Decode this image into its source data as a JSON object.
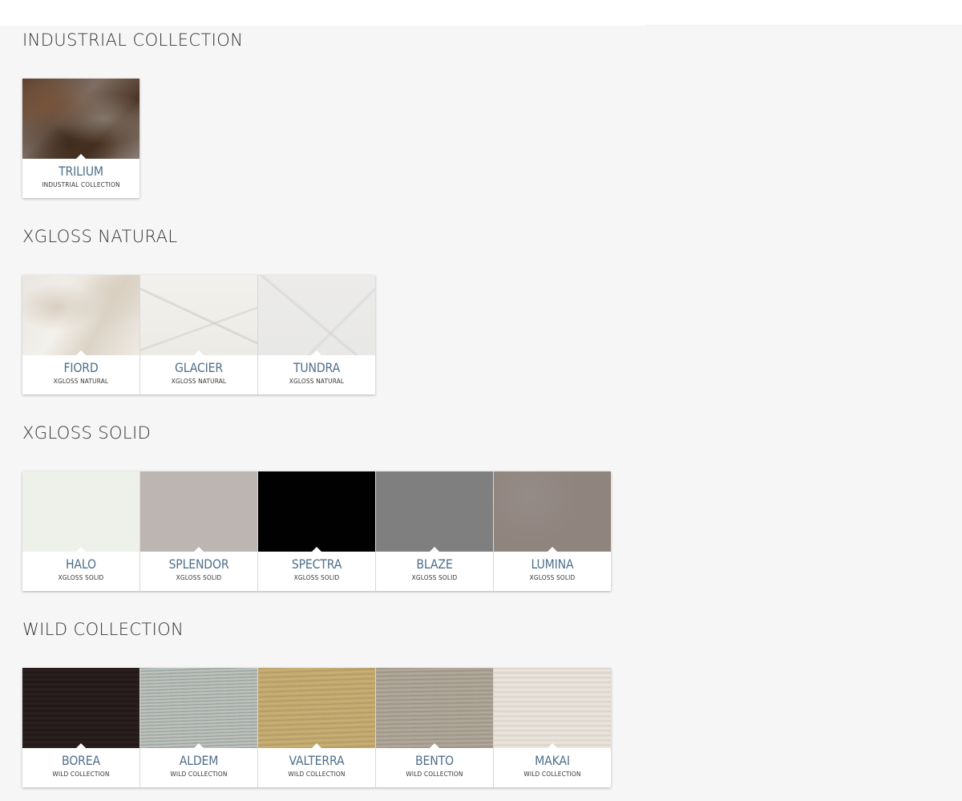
{
  "sections": [
    {
      "title": "INDUSTRIAL COLLECTION",
      "items": [
        {
          "name": "TRILIUM",
          "collection": "INDUSTRIAL COLLECTION"
        }
      ]
    },
    {
      "title": "XGLOSS NATURAL",
      "items": [
        {
          "name": "FIORD",
          "collection": "XGLOSS NATURAL"
        },
        {
          "name": "GLACIER",
          "collection": "XGLOSS NATURAL"
        },
        {
          "name": "TUNDRA",
          "collection": "XGLOSS NATURAL"
        }
      ]
    },
    {
      "title": "XGLOSS SOLID",
      "items": [
        {
          "name": "HALO",
          "collection": "XGLOSS SOLID"
        },
        {
          "name": "SPLENDOR",
          "collection": "XGLOSS SOLID"
        },
        {
          "name": "SPECTRA",
          "collection": "XGLOSS SOLID"
        },
        {
          "name": "BLAZE",
          "collection": "XGLOSS SOLID"
        },
        {
          "name": "LUMINA",
          "collection": "XGLOSS SOLID"
        }
      ]
    },
    {
      "title": "WILD COLLECTION",
      "items": [
        {
          "name": "BOREA",
          "collection": "WILD COLLECTION"
        },
        {
          "name": "ALDEM",
          "collection": "WILD COLLECTION"
        },
        {
          "name": "VALTERRA",
          "collection": "WILD COLLECTION"
        },
        {
          "name": "BENTO",
          "collection": "WILD COLLECTION"
        },
        {
          "name": "MAKAI",
          "collection": "WILD COLLECTION"
        }
      ]
    }
  ],
  "colors": {
    "background": "#f6f6f6",
    "title_text": "#333333",
    "name_text": "#4f6f8a"
  }
}
